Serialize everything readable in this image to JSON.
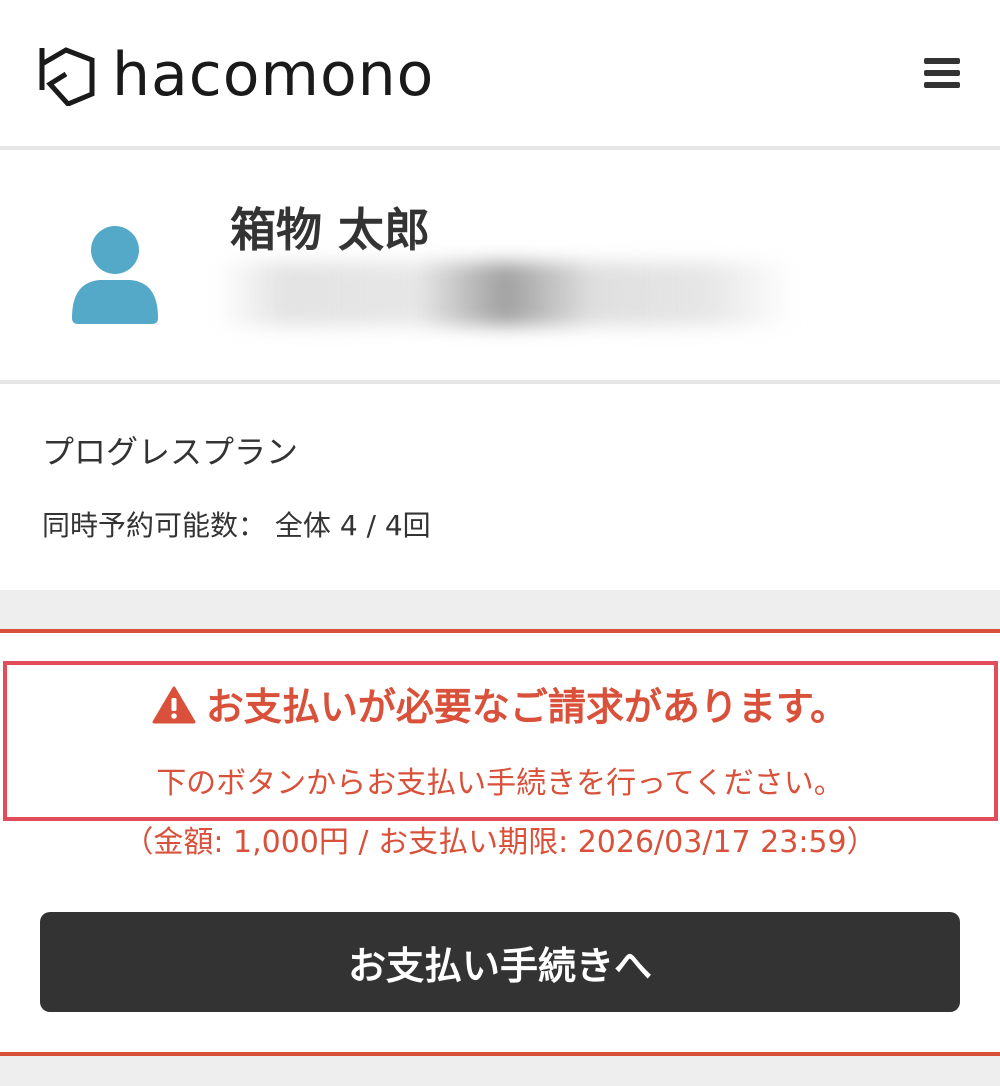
{
  "header": {
    "logo_text": "hacomono",
    "logo_icon": "hacomono-box-icon",
    "menu_icon": "hamburger-menu-icon"
  },
  "profile": {
    "avatar_icon": "user-avatar-icon",
    "avatar_color": "#55a9c8",
    "name": "箱物 太郎"
  },
  "plan": {
    "name": "プログレスプラン",
    "reservation_label": "同時予約可能数：",
    "reservation_value": "全体 4 / 4回"
  },
  "alert": {
    "icon": "warning-triangle-icon",
    "title": "お支払いが必要なご請求があります。",
    "message": "下のボタンからお支払い手続きを行ってください。",
    "detail": "（金額: 1,000円 / お支払い期限: 2026/03/17 23:59）",
    "color": "#d9513a",
    "border_color": "#e14d5a"
  },
  "pay_button": {
    "label": "お支払い手続きへ",
    "color": "#333333"
  }
}
